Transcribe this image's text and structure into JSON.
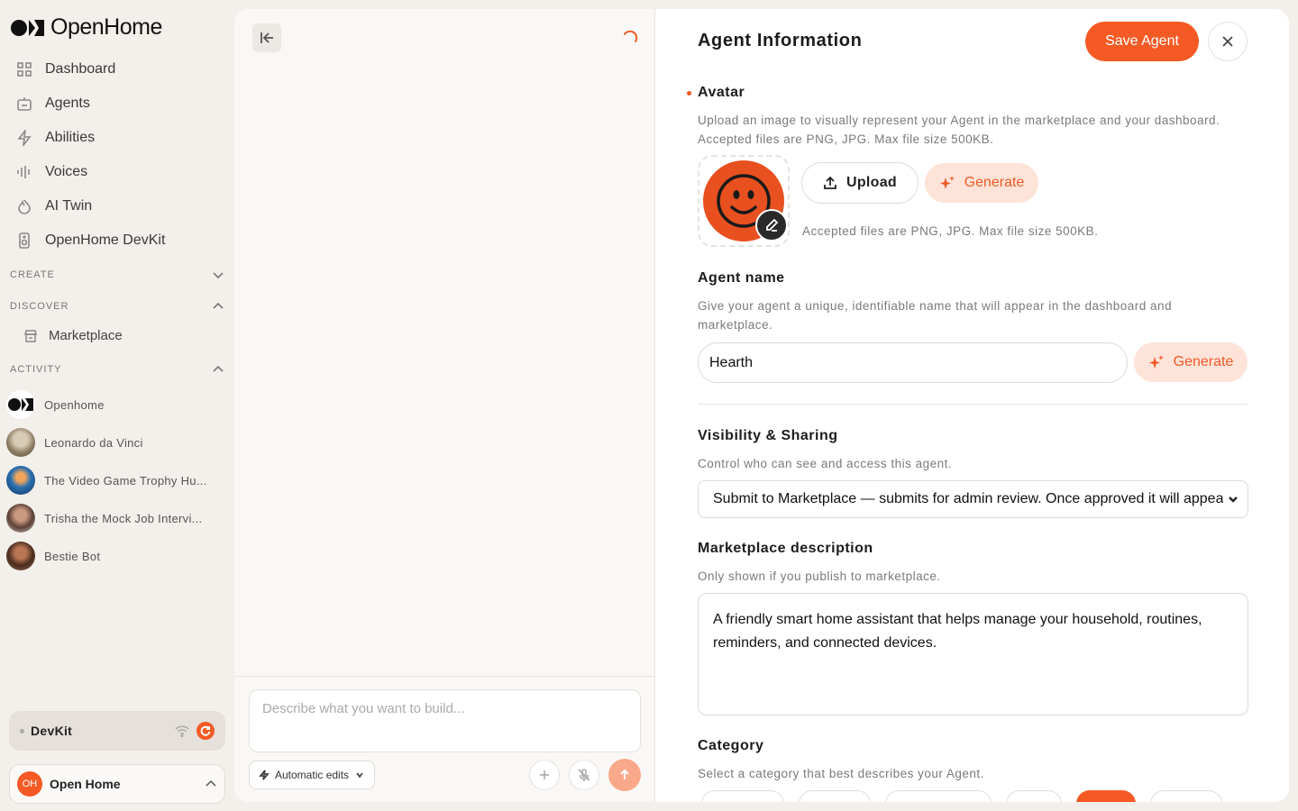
{
  "brand": {
    "name": "OpenHome"
  },
  "nav": {
    "dashboard": "Dashboard",
    "agents": "Agents",
    "abilities": "Abilities",
    "voices": "Voices",
    "ai_twin": "AI Twin",
    "devkit": "OpenHome DevKit"
  },
  "sections": {
    "create": "CREATE",
    "discover": "DISCOVER",
    "activity": "ACTIVITY"
  },
  "discover": {
    "marketplace": "Marketplace"
  },
  "activity": [
    {
      "label": "Openhome"
    },
    {
      "label": "Leonardo da Vinci"
    },
    {
      "label": "The Video Game Trophy Hu..."
    },
    {
      "label": "Trisha the Mock Job Intervi..."
    },
    {
      "label": "Bestie Bot"
    }
  ],
  "devkit": {
    "label": "DevKit"
  },
  "account": {
    "initials": "OH",
    "name": "Open Home"
  },
  "chat": {
    "placeholder": "Describe what you want to build...",
    "mode": "Automatic edits"
  },
  "panel": {
    "title": "Agent Information",
    "save": "Save Agent",
    "avatar": {
      "label": "Avatar",
      "help": "Upload an image to visually represent your Agent in the marketplace and your dashboard. Accepted files are PNG, JPG. Max file size 500KB.",
      "upload": "Upload",
      "generate": "Generate",
      "note": "Accepted files are PNG, JPG. Max file size 500KB."
    },
    "name": {
      "label": "Agent name",
      "help": "Give your agent a unique, identifiable name that will appear in the dashboard and marketplace.",
      "value": "Hearth",
      "generate": "Generate"
    },
    "visibility": {
      "label": "Visibility & Sharing",
      "help": "Control who can see and access this agent.",
      "selected": "Submit to Marketplace — submits for admin review. Once approved it will appear in the marketplace."
    },
    "description": {
      "label": "Marketplace description",
      "help": "Only shown if you publish to marketplace.",
      "value": "A friendly smart home assistant that helps manage your household, routines, reminders, and connected devices."
    },
    "category": {
      "label": "Category",
      "help": "Select a category that best describes your Agent."
    }
  },
  "colors": {
    "accent": "#f55a25",
    "accent_soft": "#fde3d8"
  }
}
